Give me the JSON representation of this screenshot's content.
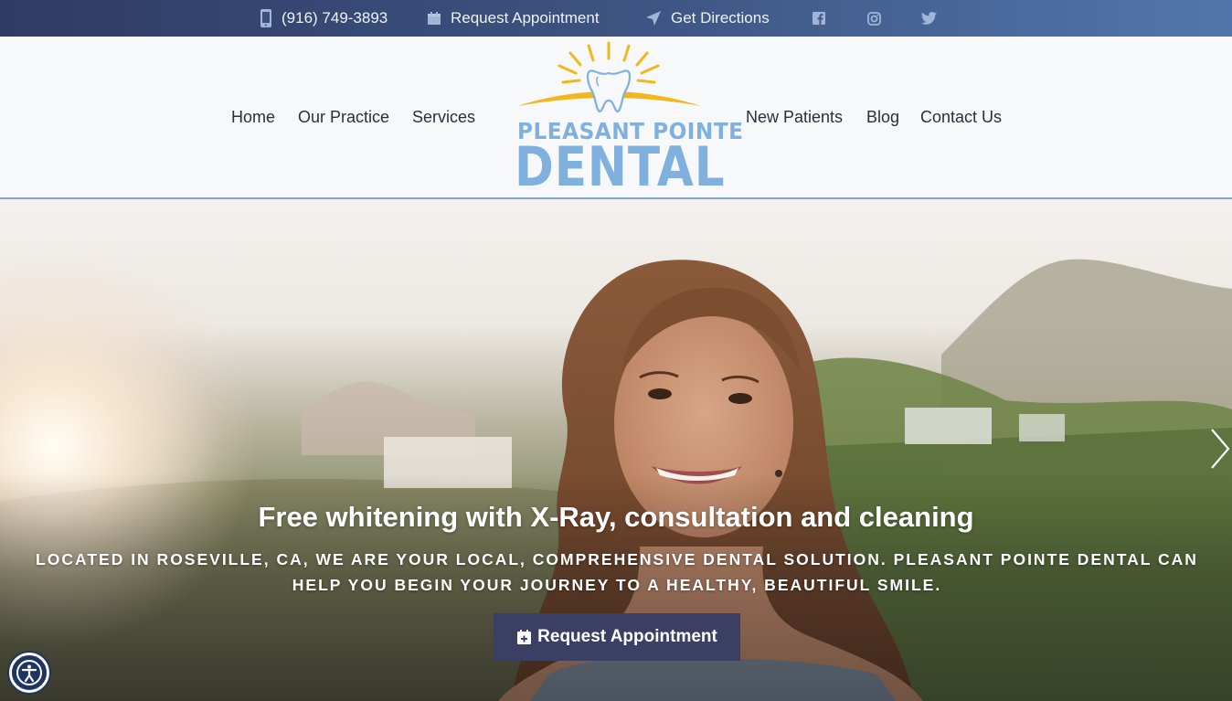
{
  "topbar": {
    "phone": "(916) 749-3893",
    "request": "Request Appointment",
    "directions": "Get Directions",
    "social": [
      "facebook-icon",
      "instagram-icon",
      "twitter-icon"
    ]
  },
  "nav": {
    "left": [
      "Home",
      "Our Practice",
      "Services"
    ],
    "right": [
      "New Patients",
      "Blog",
      "Contact Us"
    ]
  },
  "logo": {
    "line1": "PLEASANT POINTE",
    "line2": "DENTAL"
  },
  "hero": {
    "headline": "Free whitening with X-Ray, consultation and cleaning",
    "subtext": "Located in Roseville, CA, we are your local, comprehensive dental solution. Pleasant Pointe Dental can help you begin your journey to a healthy, beautiful smile.",
    "cta": "Request Appointment"
  },
  "colors": {
    "topbar_start": "#2f3b63",
    "topbar_end": "#5276ab",
    "logo_blue": "#7fb0de",
    "logo_sun": "#f2b71f",
    "cta_bg": "#3a3f63",
    "header_border": "#7fa7cc"
  }
}
